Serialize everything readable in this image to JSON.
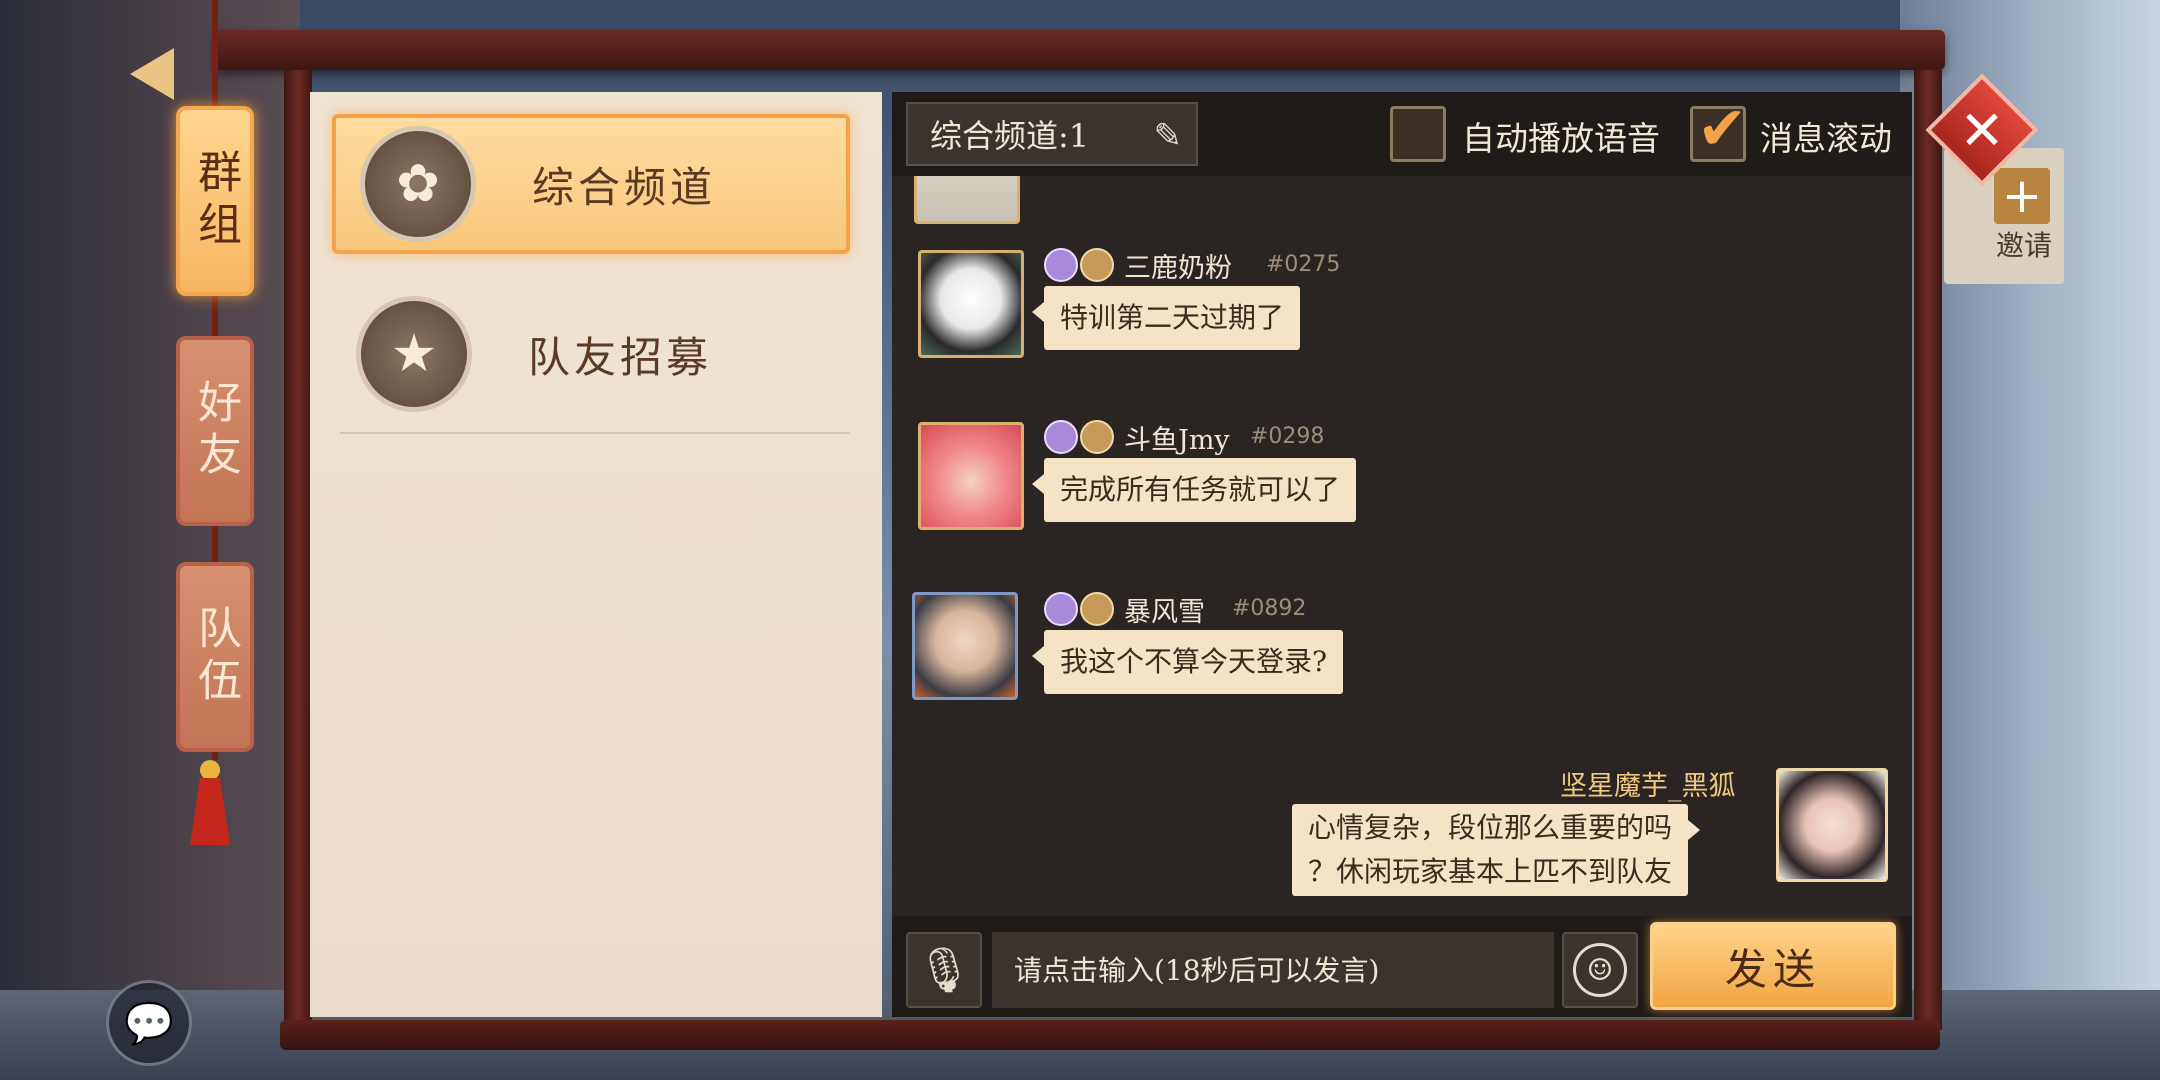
{
  "side_tabs": [
    {
      "label": "群组",
      "active": true
    },
    {
      "label": "好友",
      "active": false
    },
    {
      "label": "队伍",
      "active": false
    }
  ],
  "channels": [
    {
      "label": "综合频道",
      "icon": "sakura-icon",
      "selected": true
    },
    {
      "label": "队友招募",
      "icon": "banner-star-icon",
      "selected": false
    }
  ],
  "header": {
    "channel_select": "综合频道:1",
    "auto_voice_label": "自动播放语音",
    "auto_voice_checked": false,
    "scroll_label": "消息滚动",
    "scroll_checked": true
  },
  "messages": [
    {
      "name": "三鹿奶粉",
      "id": "#0275",
      "text": "特训第二天过期了",
      "avatar": "panda-avatar"
    },
    {
      "name": "斗鱼Jmy",
      "id": "#0298",
      "text": "完成所有任务就可以了",
      "avatar": "pink-hair-girl-avatar"
    },
    {
      "name": "暴风雪",
      "id": "#0892",
      "text": "我这个不算今天登录?",
      "avatar": "bald-man-glasses-avatar"
    }
  ],
  "own_message": {
    "name": "坚星魔芋_黑狐",
    "line1": "心情复杂，段位那么重要的吗",
    "line2": "？休闲玩家基本上匹不到队友",
    "avatar": "red-glasses-girl-avatar"
  },
  "input": {
    "placeholder": "请点击输入(18秒后可以发言)",
    "send_label": "发送"
  },
  "invite": {
    "label": "邀请"
  },
  "colors": {
    "accent": "#f1a24a",
    "bubble": "#f6e2c4",
    "frame": "#6a2a22",
    "chat_bg": "#2a2522",
    "list_bg": "#efe4d2"
  }
}
